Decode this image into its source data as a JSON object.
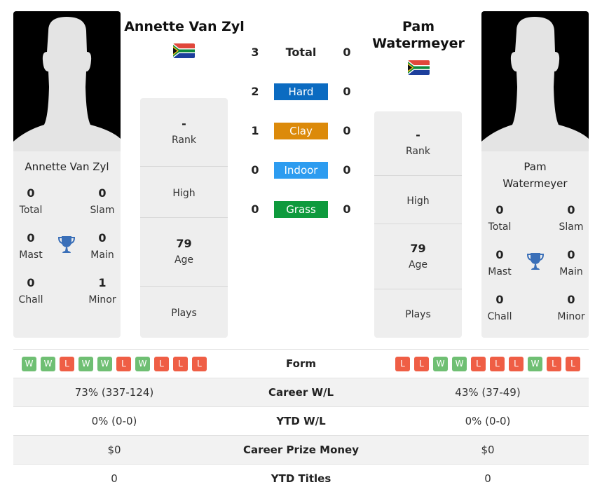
{
  "colors": {
    "hard": "#0b6bc1",
    "clay": "#dc8a0a",
    "indoor": "#2d9cf0",
    "grass": "#0e9a3d",
    "win": "#6fbf73",
    "loss": "#ef5e45",
    "trophy": "#3a6fb8"
  },
  "player1": {
    "name": "Annette Van Zyl",
    "flag": "south-africa-flag",
    "titles": [
      {
        "value": "0",
        "label": "Total"
      },
      {
        "value": "0",
        "label": "Slam"
      },
      {
        "value": "0",
        "label": "Mast"
      },
      {
        "value": "0",
        "label": "Main"
      },
      {
        "value": "0",
        "label": "Chall"
      },
      {
        "value": "1",
        "label": "Minor"
      }
    ],
    "info": {
      "rank_value": "-",
      "rank_label": "Rank",
      "high_label": "High",
      "age_value": "79",
      "age_label": "Age",
      "plays_label": "Plays"
    },
    "form": [
      "W",
      "W",
      "L",
      "W",
      "W",
      "L",
      "W",
      "L",
      "L",
      "L"
    ]
  },
  "player2": {
    "name_line1": "Pam",
    "name_line2": "Watermeyer",
    "flag": "south-africa-flag",
    "titles": [
      {
        "value": "0",
        "label": "Total"
      },
      {
        "value": "0",
        "label": "Slam"
      },
      {
        "value": "0",
        "label": "Mast"
      },
      {
        "value": "0",
        "label": "Main"
      },
      {
        "value": "0",
        "label": "Chall"
      },
      {
        "value": "0",
        "label": "Minor"
      }
    ],
    "info": {
      "rank_value": "-",
      "rank_label": "Rank",
      "high_label": "High",
      "age_value": "79",
      "age_label": "Age",
      "plays_label": "Plays"
    },
    "form": [
      "L",
      "L",
      "W",
      "W",
      "L",
      "L",
      "L",
      "W",
      "L",
      "L"
    ]
  },
  "h2h": [
    {
      "label": "Total",
      "p1": "3",
      "p2": "0"
    },
    {
      "label": "Hard",
      "p1": "2",
      "p2": "0"
    },
    {
      "label": "Clay",
      "p1": "1",
      "p2": "0"
    },
    {
      "label": "Indoor",
      "p1": "0",
      "p2": "0"
    },
    {
      "label": "Grass",
      "p1": "0",
      "p2": "0"
    }
  ],
  "stats": [
    {
      "label": "Form"
    },
    {
      "label": "Career W/L",
      "p1": "73% (337-124)",
      "p2": "43% (37-49)"
    },
    {
      "label": "YTD W/L",
      "p1": "0% (0-0)",
      "p2": "0% (0-0)"
    },
    {
      "label": "Career Prize Money",
      "p1": "$0",
      "p2": "$0"
    },
    {
      "label": "YTD Titles",
      "p1": "0",
      "p2": "0"
    }
  ]
}
